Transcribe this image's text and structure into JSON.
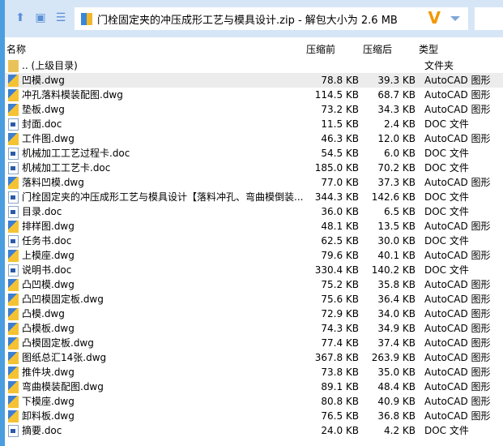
{
  "address": {
    "text": "门栓固定夹的冲压成形工艺与模具设计.zip - 解包大小为 2.6 MB"
  },
  "columns": {
    "name": "名称",
    "orig": "压缩前",
    "comp": "压缩后",
    "type": "类型"
  },
  "parent": {
    "name": ".. (上级目录)",
    "type": "文件夹"
  },
  "files": [
    {
      "name": "凹模.dwg",
      "orig": "78.8 KB",
      "comp": "39.3 KB",
      "type": "AutoCAD 图形",
      "icon": "dwg"
    },
    {
      "name": "冲孔落料模装配图.dwg",
      "orig": "114.5 KB",
      "comp": "68.7 KB",
      "type": "AutoCAD 图形",
      "icon": "dwg"
    },
    {
      "name": "垫板.dwg",
      "orig": "73.2 KB",
      "comp": "34.3 KB",
      "type": "AutoCAD 图形",
      "icon": "dwg"
    },
    {
      "name": "封面.doc",
      "orig": "11.5 KB",
      "comp": "2.4 KB",
      "type": "DOC 文件",
      "icon": "doc"
    },
    {
      "name": "工件图.dwg",
      "orig": "46.3 KB",
      "comp": "12.0 KB",
      "type": "AutoCAD 图形",
      "icon": "dwg"
    },
    {
      "name": "机械加工工艺过程卡.doc",
      "orig": "54.5 KB",
      "comp": "6.0 KB",
      "type": "DOC 文件",
      "icon": "doc"
    },
    {
      "name": "机械加工工艺卡.doc",
      "orig": "185.0 KB",
      "comp": "70.2 KB",
      "type": "DOC 文件",
      "icon": "doc"
    },
    {
      "name": "落料凹模.dwg",
      "orig": "77.0 KB",
      "comp": "37.3 KB",
      "type": "AutoCAD 图形",
      "icon": "dwg"
    },
    {
      "name": "门栓固定夹的冲压成形工艺与模具设计【落料冲孔、弯曲模倒装...",
      "orig": "344.3 KB",
      "comp": "142.6 KB",
      "type": "DOC 文件",
      "icon": "doc"
    },
    {
      "name": "目录.doc",
      "orig": "36.0 KB",
      "comp": "6.5 KB",
      "type": "DOC 文件",
      "icon": "doc"
    },
    {
      "name": "排样图.dwg",
      "orig": "48.1 KB",
      "comp": "13.5 KB",
      "type": "AutoCAD 图形",
      "icon": "dwg"
    },
    {
      "name": "任务书.doc",
      "orig": "62.5 KB",
      "comp": "30.0 KB",
      "type": "DOC 文件",
      "icon": "doc"
    },
    {
      "name": "上模座.dwg",
      "orig": "79.6 KB",
      "comp": "40.1 KB",
      "type": "AutoCAD 图形",
      "icon": "dwg"
    },
    {
      "name": "说明书.doc",
      "orig": "330.4 KB",
      "comp": "140.2 KB",
      "type": "DOC 文件",
      "icon": "doc"
    },
    {
      "name": "凸凹模.dwg",
      "orig": "75.2 KB",
      "comp": "35.8 KB",
      "type": "AutoCAD 图形",
      "icon": "dwg"
    },
    {
      "name": "凸凹模固定板.dwg",
      "orig": "75.6 KB",
      "comp": "36.4 KB",
      "type": "AutoCAD 图形",
      "icon": "dwg"
    },
    {
      "name": "凸模.dwg",
      "orig": "72.9 KB",
      "comp": "34.0 KB",
      "type": "AutoCAD 图形",
      "icon": "dwg"
    },
    {
      "name": "凸模板.dwg",
      "orig": "74.3 KB",
      "comp": "34.9 KB",
      "type": "AutoCAD 图形",
      "icon": "dwg"
    },
    {
      "name": "凸模固定板.dwg",
      "orig": "77.4 KB",
      "comp": "37.4 KB",
      "type": "AutoCAD 图形",
      "icon": "dwg"
    },
    {
      "name": "图纸总汇14张.dwg",
      "orig": "367.8 KB",
      "comp": "263.9 KB",
      "type": "AutoCAD 图形",
      "icon": "dwg"
    },
    {
      "name": "推件块.dwg",
      "orig": "73.8 KB",
      "comp": "35.0 KB",
      "type": "AutoCAD 图形",
      "icon": "dwg"
    },
    {
      "name": "弯曲模装配图.dwg",
      "orig": "89.1 KB",
      "comp": "48.4 KB",
      "type": "AutoCAD 图形",
      "icon": "dwg"
    },
    {
      "name": "下模座.dwg",
      "orig": "80.8 KB",
      "comp": "40.9 KB",
      "type": "AutoCAD 图形",
      "icon": "dwg"
    },
    {
      "name": "卸料板.dwg",
      "orig": "76.5 KB",
      "comp": "36.8 KB",
      "type": "AutoCAD 图形",
      "icon": "dwg"
    },
    {
      "name": "摘要.doc",
      "orig": "24.0 KB",
      "comp": "4.2 KB",
      "type": "DOC 文件",
      "icon": "doc"
    }
  ]
}
